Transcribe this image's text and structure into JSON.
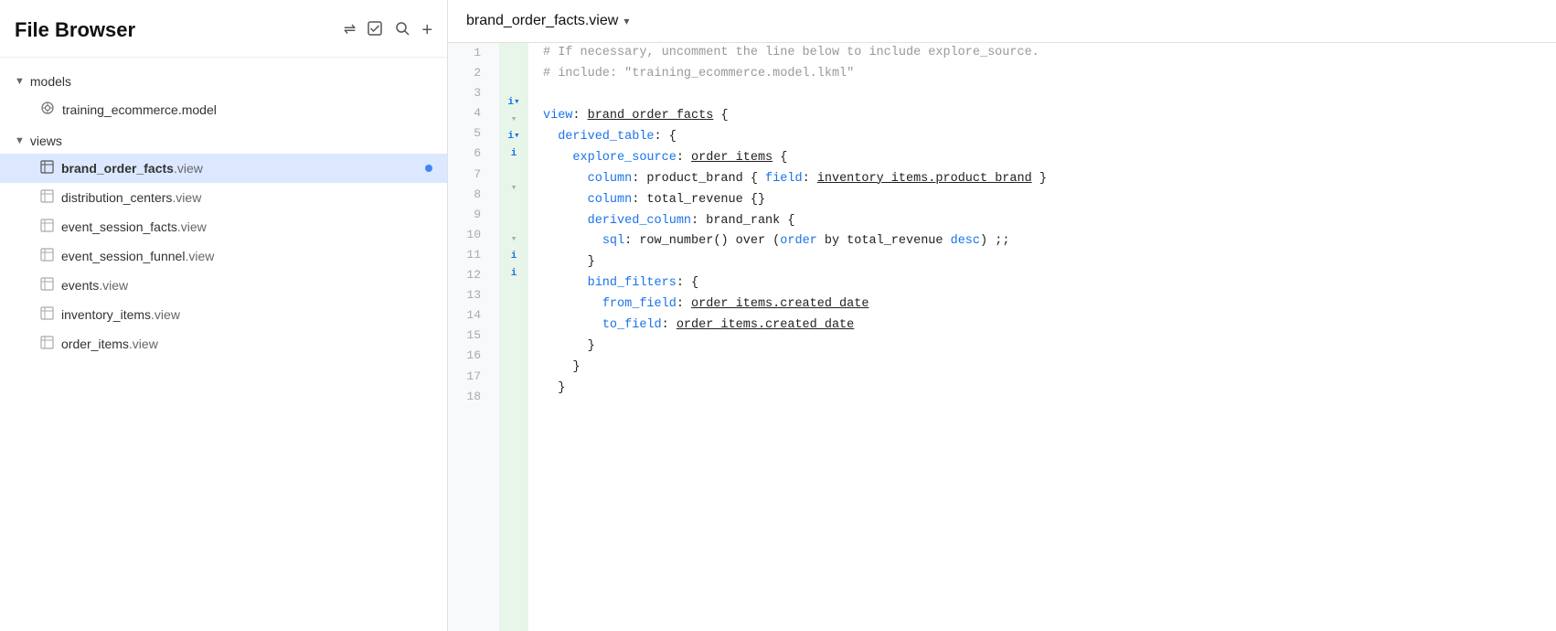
{
  "sidebar": {
    "title": "File Browser",
    "icons": [
      "split-icon",
      "checkbox-icon",
      "search-icon",
      "add-icon"
    ],
    "sections": [
      {
        "id": "models",
        "label": "models",
        "expanded": true,
        "items": [
          {
            "id": "training-ecommerce-model",
            "icon": "model-icon",
            "name_bold": "training_ecommerce",
            "name_ext": ".model",
            "dot": true
          }
        ]
      },
      {
        "id": "views",
        "label": "views",
        "expanded": true,
        "items": [
          {
            "id": "brand-order-facts",
            "icon": "view-icon",
            "name_bold": "brand_order_facts",
            "name_ext": ".view",
            "active": true,
            "dot": true
          },
          {
            "id": "distribution-centers",
            "icon": "view-icon",
            "name_bold": "distribution_centers",
            "name_ext": ".view",
            "active": false,
            "dot": false
          },
          {
            "id": "event-session-facts",
            "icon": "view-icon",
            "name_bold": "event_session_facts",
            "name_ext": ".view",
            "active": false,
            "dot": false
          },
          {
            "id": "event-session-funnel",
            "icon": "view-icon",
            "name_bold": "event_session_funnel",
            "name_ext": ".view",
            "active": false,
            "dot": false
          },
          {
            "id": "events",
            "icon": "view-icon",
            "name_bold": "events",
            "name_ext": ".view",
            "active": false,
            "dot": false
          },
          {
            "id": "inventory-items",
            "icon": "view-icon",
            "name_bold": "inventory_items",
            "name_ext": ".view",
            "active": false,
            "dot": false
          },
          {
            "id": "order-items",
            "icon": "view-icon",
            "name_bold": "order_items",
            "name_ext": ".view",
            "active": false,
            "dot": false
          }
        ]
      }
    ]
  },
  "editor": {
    "file_tab": "brand_order_facts.view",
    "lines": [
      {
        "num": 1,
        "gutter": "",
        "code": "comment",
        "text": "# If necessary, uncomment the line below to include explore_source."
      },
      {
        "num": 2,
        "gutter": "",
        "code": "comment",
        "text": "# include: \"training_ecommerce.model.lkml\""
      },
      {
        "num": 3,
        "gutter": "",
        "code": "empty",
        "text": ""
      },
      {
        "num": 4,
        "gutter": "i▾",
        "code": "view_decl",
        "text": "view: brand_order_facts {"
      },
      {
        "num": 5,
        "gutter": "▾",
        "code": "dt_start",
        "text": "  derived_table: {"
      },
      {
        "num": 6,
        "gutter": "i▾",
        "code": "es_start",
        "text": "    explore_source: order_items {"
      },
      {
        "num": 7,
        "gutter": "i",
        "code": "col1",
        "text": "      column: product_brand { field: inventory_items.product_brand }"
      },
      {
        "num": 8,
        "gutter": "",
        "code": "col2",
        "text": "      column: total_revenue {}"
      },
      {
        "num": 9,
        "gutter": "▾",
        "code": "dc_start",
        "text": "      derived_column: brand_rank {"
      },
      {
        "num": 10,
        "gutter": "",
        "code": "sql",
        "text": "        sql: row_number() over (order by total_revenue desc) ;;"
      },
      {
        "num": 11,
        "gutter": "",
        "code": "close1",
        "text": "      }"
      },
      {
        "num": 12,
        "gutter": "▾",
        "code": "bf_start",
        "text": "      bind_filters: {"
      },
      {
        "num": 13,
        "gutter": "i",
        "code": "from",
        "text": "        from_field: order_items.created_date"
      },
      {
        "num": 14,
        "gutter": "i",
        "code": "to",
        "text": "        to_field: order_items.created_date"
      },
      {
        "num": 15,
        "gutter": "",
        "code": "close2",
        "text": "      }"
      },
      {
        "num": 16,
        "gutter": "",
        "code": "close3",
        "text": "    }"
      },
      {
        "num": 17,
        "gutter": "",
        "code": "close4",
        "text": "  }"
      },
      {
        "num": 18,
        "gutter": "",
        "code": "empty2",
        "text": ""
      }
    ]
  }
}
